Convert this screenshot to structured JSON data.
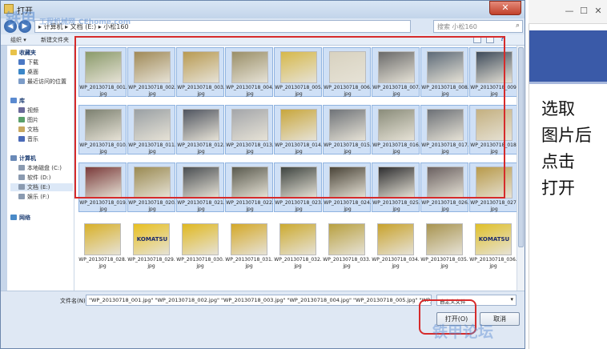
{
  "dialog": {
    "title": "打开",
    "address": "▸ 计算机 ▸ 文档 (E:) ▸ 小松160",
    "search_placeholder": "搜索 小松160",
    "toolbar": {
      "organize": "组织 ▾",
      "new_folder": "新建文件夹"
    }
  },
  "nav": {
    "favorites": "收藏夹",
    "favorites_items": [
      "下载",
      "桌面",
      "最近访问的位置"
    ],
    "libraries": "库",
    "library_items": [
      "视频",
      "图片",
      "文档",
      "音乐"
    ],
    "computer": "计算机",
    "computer_items": [
      "本地磁盘 (C:)",
      "软件 (D:)",
      "文档 (E:)",
      "娱乐 (F:)"
    ],
    "network": "网络"
  },
  "files": [
    {
      "name": "WP_20130718_001.jpg",
      "selected": true,
      "color": "#8a9a6a"
    },
    {
      "name": "WP_20130718_002.jpg",
      "selected": true,
      "color": "#a08a58"
    },
    {
      "name": "WP_20130718_003.jpg",
      "selected": true,
      "color": "#b89a52"
    },
    {
      "name": "WP_20130718_004.jpg",
      "selected": true,
      "color": "#9a8f68"
    },
    {
      "name": "WP_20130718_005.jpg",
      "selected": true,
      "color": "#d6b84a"
    },
    {
      "name": "WP_20130718_006.jpg",
      "selected": true,
      "color": "#d8d2c0"
    },
    {
      "name": "WP_20130718_007.jpg",
      "selected": true,
      "color": "#6a6a6a"
    },
    {
      "name": "WP_20130718_008.jpg",
      "selected": true,
      "color": "#5d6a78"
    },
    {
      "name": "WP_20130718_009.jpg",
      "selected": true,
      "color": "#3d4a5a"
    },
    {
      "name": "WP_20130718_010.jpg",
      "selected": true,
      "color": "#7c8070"
    },
    {
      "name": "WP_20130718_011.jpg",
      "selected": true,
      "color": "#9aa0a4"
    },
    {
      "name": "WP_20130718_012.jpg",
      "selected": true,
      "color": "#505560"
    },
    {
      "name": "WP_20130718_013.jpg",
      "selected": true,
      "color": "#a4a6aa"
    },
    {
      "name": "WP_20130718_014.jpg",
      "selected": true,
      "color": "#c8a63c"
    },
    {
      "name": "WP_20130718_015.jpg",
      "selected": true,
      "color": "#6f7378"
    },
    {
      "name": "WP_20130718_016.jpg",
      "selected": true,
      "color": "#8a8c7a"
    },
    {
      "name": "WP_20130718_017.jpg",
      "selected": true,
      "color": "#6c7076"
    },
    {
      "name": "WP_20130718_018.jpg",
      "selected": true,
      "color": "#c4b080"
    },
    {
      "name": "WP_20130718_019.jpg",
      "selected": true,
      "color": "#7a3a3a"
    },
    {
      "name": "WP_20130718_020.jpg",
      "selected": true,
      "color": "#9a8a52"
    },
    {
      "name": "WP_20130718_021.jpg",
      "selected": true,
      "color": "#4a4e52"
    },
    {
      "name": "WP_20130718_022.jpg",
      "selected": true,
      "color": "#5a5a4e"
    },
    {
      "name": "WP_20130718_023.jpg",
      "selected": true,
      "color": "#3e4440"
    },
    {
      "name": "WP_20130718_024.jpg",
      "selected": true,
      "color": "#4a4438"
    },
    {
      "name": "WP_20130718_025.jpg",
      "selected": true,
      "color": "#2e2e30"
    },
    {
      "name": "WP_20130718_026.jpg",
      "selected": true,
      "color": "#6a6060"
    },
    {
      "name": "WP_20130718_027.jpg",
      "selected": true,
      "color": "#b89a4a"
    },
    {
      "name": "WP_20130718_028.jpg",
      "selected": false,
      "color": "#d8b028"
    },
    {
      "name": "WP_20130718_029.jpg",
      "selected": false,
      "color": "#e8c020",
      "logo": "KOMATSU"
    },
    {
      "name": "WP_20130718_030.jpg",
      "selected": false,
      "color": "#e0b820"
    },
    {
      "name": "WP_20130718_031.jpg",
      "selected": false,
      "color": "#d4a828"
    },
    {
      "name": "WP_20130718_032.jpg",
      "selected": false,
      "color": "#ccaa30"
    },
    {
      "name": "WP_20130718_033.jpg",
      "selected": false,
      "color": "#b8a040"
    },
    {
      "name": "WP_20130718_034.jpg",
      "selected": false,
      "color": "#c8a22c"
    },
    {
      "name": "WP_20130718_035.jpg",
      "selected": false,
      "color": "#a89450"
    },
    {
      "name": "WP_20130718_036.jpg",
      "selected": false,
      "color": "#e0c028",
      "logo": "KOMATSU"
    }
  ],
  "filename": {
    "label": "文件名(N):",
    "value": "\"WP_20130718_001.jpg\" \"WP_20130718_002.jpg\" \"WP_20130718_003.jpg\" \"WP_20130718_004.jpg\" \"WP_20130718_005.jpg\" \"WP_2013071"
  },
  "filetype": {
    "value": "自定义文件"
  },
  "buttons": {
    "open": "打开(O)",
    "cancel": "取消"
  },
  "instruction": [
    "选取",
    "图片后",
    "点击",
    "打开"
  ],
  "watermark": {
    "main": "铁甲",
    "sub": "工程机械网",
    "url": "CEhome.com",
    "corner": "铁甲论坛"
  },
  "colors": {
    "highlight": "#d62b2b",
    "selection": "#cfe0f6",
    "frame": "#c7d6ea"
  }
}
